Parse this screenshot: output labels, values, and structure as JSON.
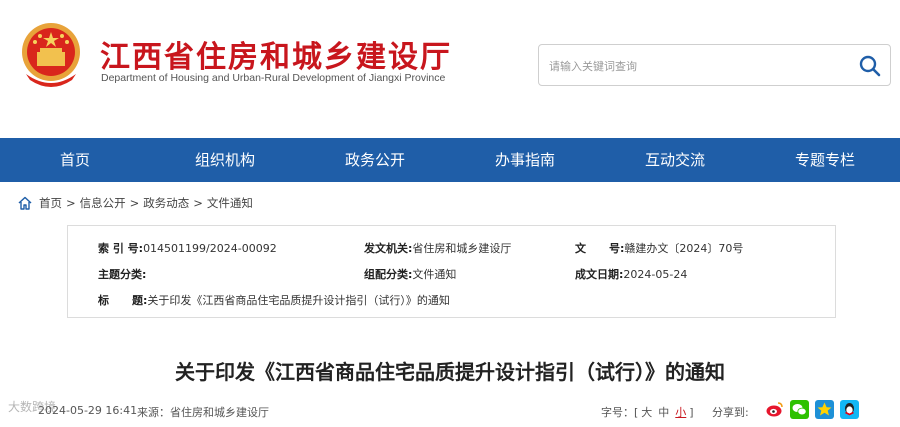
{
  "header": {
    "title": "江西省住房和城乡建设厅",
    "subtitle": "Department of Housing and Urban-Rural Development of Jiangxi Province",
    "search_placeholder": "请输入关键词查询"
  },
  "nav": [
    {
      "label": "首页"
    },
    {
      "label": "组织机构"
    },
    {
      "label": "政务公开"
    },
    {
      "label": "办事指南"
    },
    {
      "label": "互动交流"
    },
    {
      "label": "专题专栏"
    }
  ],
  "breadcrumb": [
    "首页",
    "信息公开",
    "政务动态",
    "文件通知"
  ],
  "breadcrumb_sep": ">",
  "meta": {
    "index_key": "索 引 号:",
    "index_val": "014501199/2024-00092",
    "issuer_key": "发文机关:",
    "issuer_val": "省住房和城乡建设厅",
    "docno_key": "文      号:",
    "docno_val": "赣建办文〔2024〕70号",
    "topic_key": "主题分类:",
    "topic_val": "",
    "category_key": "组配分类:",
    "category_val": "文件通知",
    "date_key": "成文日期:",
    "date_val": "2024-05-24",
    "title_key": "标      题:",
    "title_val": "关于印发《江西省商品住宅品质提升设计指引（试行）》的通知"
  },
  "doc_title": "关于印发《江西省商品住宅品质提升设计指引（试行）》的通知",
  "info": {
    "date": "2024-05-29 16:41",
    "source": "来源：省住房和城乡建设厅",
    "font_label": "字号：[",
    "font_large": "大",
    "font_medium": "中",
    "font_small": "小",
    "font_close": "]",
    "share_label": "分享到:"
  },
  "share_icons": [
    "weibo-icon",
    "wechat-icon",
    "qzone-icon",
    "qq-icon"
  ],
  "watermark": "大数跨境",
  "colors": {
    "brand_red": "#c8161d",
    "nav_blue": "#1f5ea8"
  }
}
